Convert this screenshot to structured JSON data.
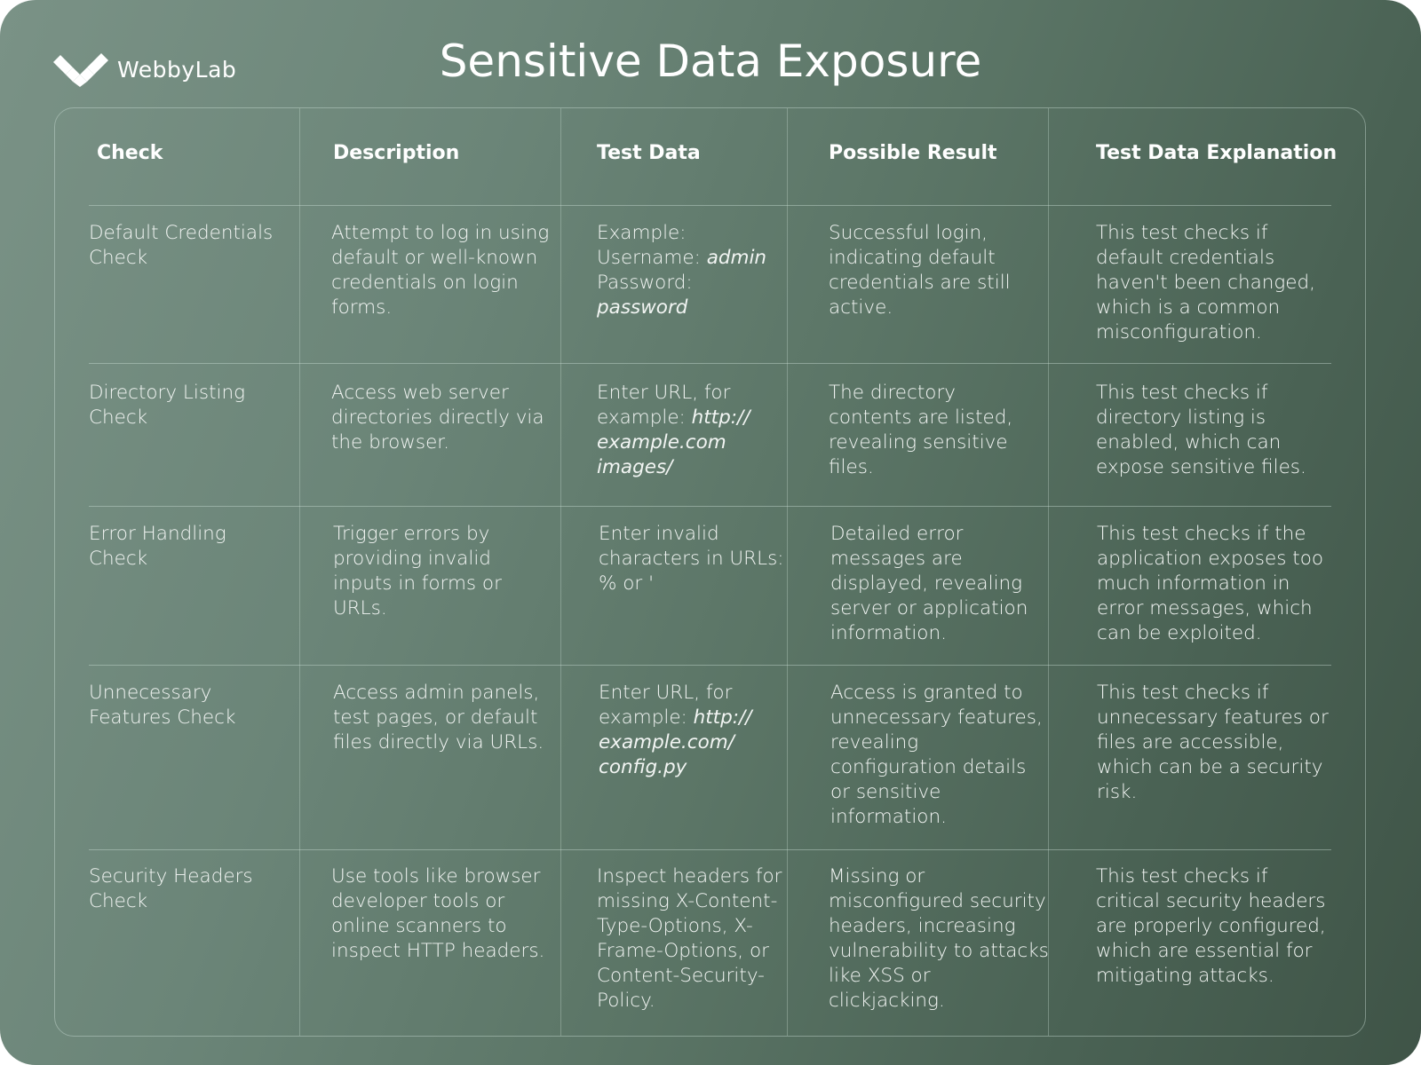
{
  "brand": {
    "logo_icon": "webbylab-logo-icon",
    "name": "WebbyLab"
  },
  "title": "Sensitive Data Exposure",
  "table": {
    "headers": [
      "Check",
      "Description",
      "Test Data",
      "Possible Result",
      "Test Data Explanation"
    ],
    "rows": [
      {
        "check": "Default Credentials Check",
        "description": "Attempt to log in using default or well-known credentials on login forms.",
        "test_data": {
          "parts": [
            {
              "text": "Example:",
              "italic": false,
              "br": true
            },
            {
              "text": "Username: ",
              "italic": false
            },
            {
              "text": "admin",
              "italic": true,
              "br": true
            },
            {
              "text": "Password: ",
              "italic": false
            },
            {
              "text": "password",
              "italic": true
            }
          ]
        },
        "result": "Successful login, indicating default credentials are still active.",
        "explanation": "This test checks if default credentials haven't been changed, which is a common misconfiguration."
      },
      {
        "check": "Directory Listing Check",
        "description": "Access web server directories directly via the browser.",
        "test_data": {
          "parts": [
            {
              "text": "Enter URL, for example: ",
              "italic": false
            },
            {
              "text": "http:// example.com images/",
              "italic": true
            }
          ]
        },
        "result": "The directory contents are listed, revealing sensitive files.",
        "explanation": "This test checks if directory listing is enabled, which can expose sensitive files."
      },
      {
        "check": "Error Handling Check",
        "description": "Trigger errors by providing invalid inputs in forms or URLs.",
        "test_data": {
          "parts": [
            {
              "text": "Enter invalid characters in URLs: % or '",
              "italic": false
            }
          ]
        },
        "result": "Detailed error messages are displayed, revealing server or application information.",
        "explanation": "This test checks if the application exposes too much information in error messages, which can be exploited."
      },
      {
        "check": "Unnecessary Features Check",
        "description": "Access admin panels, test pages, or default files directly via URLs.",
        "test_data": {
          "parts": [
            {
              "text": "Enter URL, for example: ",
              "italic": false
            },
            {
              "text": "http:// example.com/ config.py",
              "italic": true
            }
          ]
        },
        "result": "Access is granted to unnecessary features, revealing configuration details or sensitive information.",
        "explanation": "This test checks if unnecessary features or files are accessible, which can be a security risk."
      },
      {
        "check": "Security Headers Check",
        "description": "Use tools like browser developer tools or online scanners to inspect HTTP headers.",
        "test_data": {
          "parts": [
            {
              "text": "Inspect headers for missing X-Content-Type-Options, X-Frame-Options, or Content-Security-Policy.",
              "italic": false
            }
          ]
        },
        "result": "Missing or misconfigured security headers, increasing vulnerability to attacks like XSS or clickjacking.",
        "explanation": "This test checks if critical security headers are properly configured, which are essential for mitigating attacks."
      }
    ]
  }
}
